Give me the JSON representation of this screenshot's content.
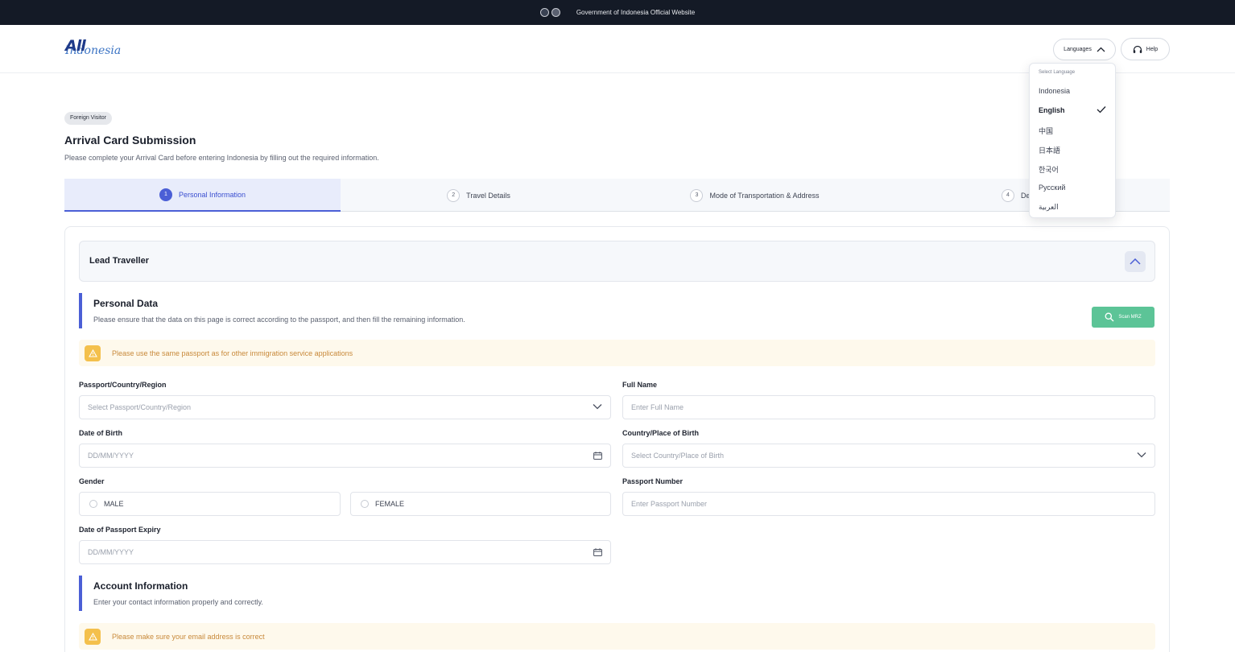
{
  "gov_bar": {
    "text": "Government of Indonesia Official Website"
  },
  "header": {
    "logo": {
      "primary": "All",
      "secondary": "Indonesia"
    },
    "languages_label": "Languages",
    "help_label": "Help"
  },
  "language_menu": {
    "heading": "Select Language",
    "selected": "English",
    "items": [
      "Indonesia",
      "English",
      "中国",
      "日本語",
      "한국어",
      "Русский",
      "العربية"
    ]
  },
  "page": {
    "badge": "Foreign Visitor",
    "title": "Arrival Card Submission",
    "description": "Please complete your Arrival Card before entering Indonesia by filling out the required information."
  },
  "stepper": {
    "steps": [
      {
        "num": "1",
        "label": "Personal Information"
      },
      {
        "num": "2",
        "label": "Travel Details"
      },
      {
        "num": "3",
        "label": "Mode of Transportation & Address"
      },
      {
        "num": "4",
        "label": "De"
      }
    ]
  },
  "lead_traveller": {
    "title": "Lead Traveller"
  },
  "personal_data": {
    "title": "Personal Data",
    "description": "Please ensure that the data on this page is correct according to the passport, and then fill the remaining information.",
    "scan_label": "Scan MRZ",
    "alert": "Please use the same passport as for other immigration service applications"
  },
  "form": {
    "passport_country": {
      "label": "Passport/Country/Region",
      "placeholder": "Select Passport/Country/Region"
    },
    "full_name": {
      "label": "Full Name",
      "placeholder": "Enter Full Name"
    },
    "dob": {
      "label": "Date of Birth",
      "placeholder": "DD/MM/YYYY"
    },
    "birth_place": {
      "label": "Country/Place of Birth",
      "placeholder": "Select Country/Place of Birth"
    },
    "gender": {
      "label": "Gender",
      "male": "MALE",
      "female": "FEMALE"
    },
    "passport_number": {
      "label": "Passport Number",
      "placeholder": "Enter Passport Number"
    },
    "passport_expiry": {
      "label": "Date of Passport Expiry",
      "placeholder": "DD/MM/YYYY"
    }
  },
  "account_info": {
    "title": "Account Information",
    "description": "Enter your contact information properly and correctly.",
    "alert": "Please make sure your email address is correct"
  },
  "colors": {
    "primary": "#4b5fd6",
    "scan": "#5cc497",
    "alert_bg": "#fef9ec",
    "alert_icon": "#f4c04c",
    "gov_bar": "#141a26"
  }
}
